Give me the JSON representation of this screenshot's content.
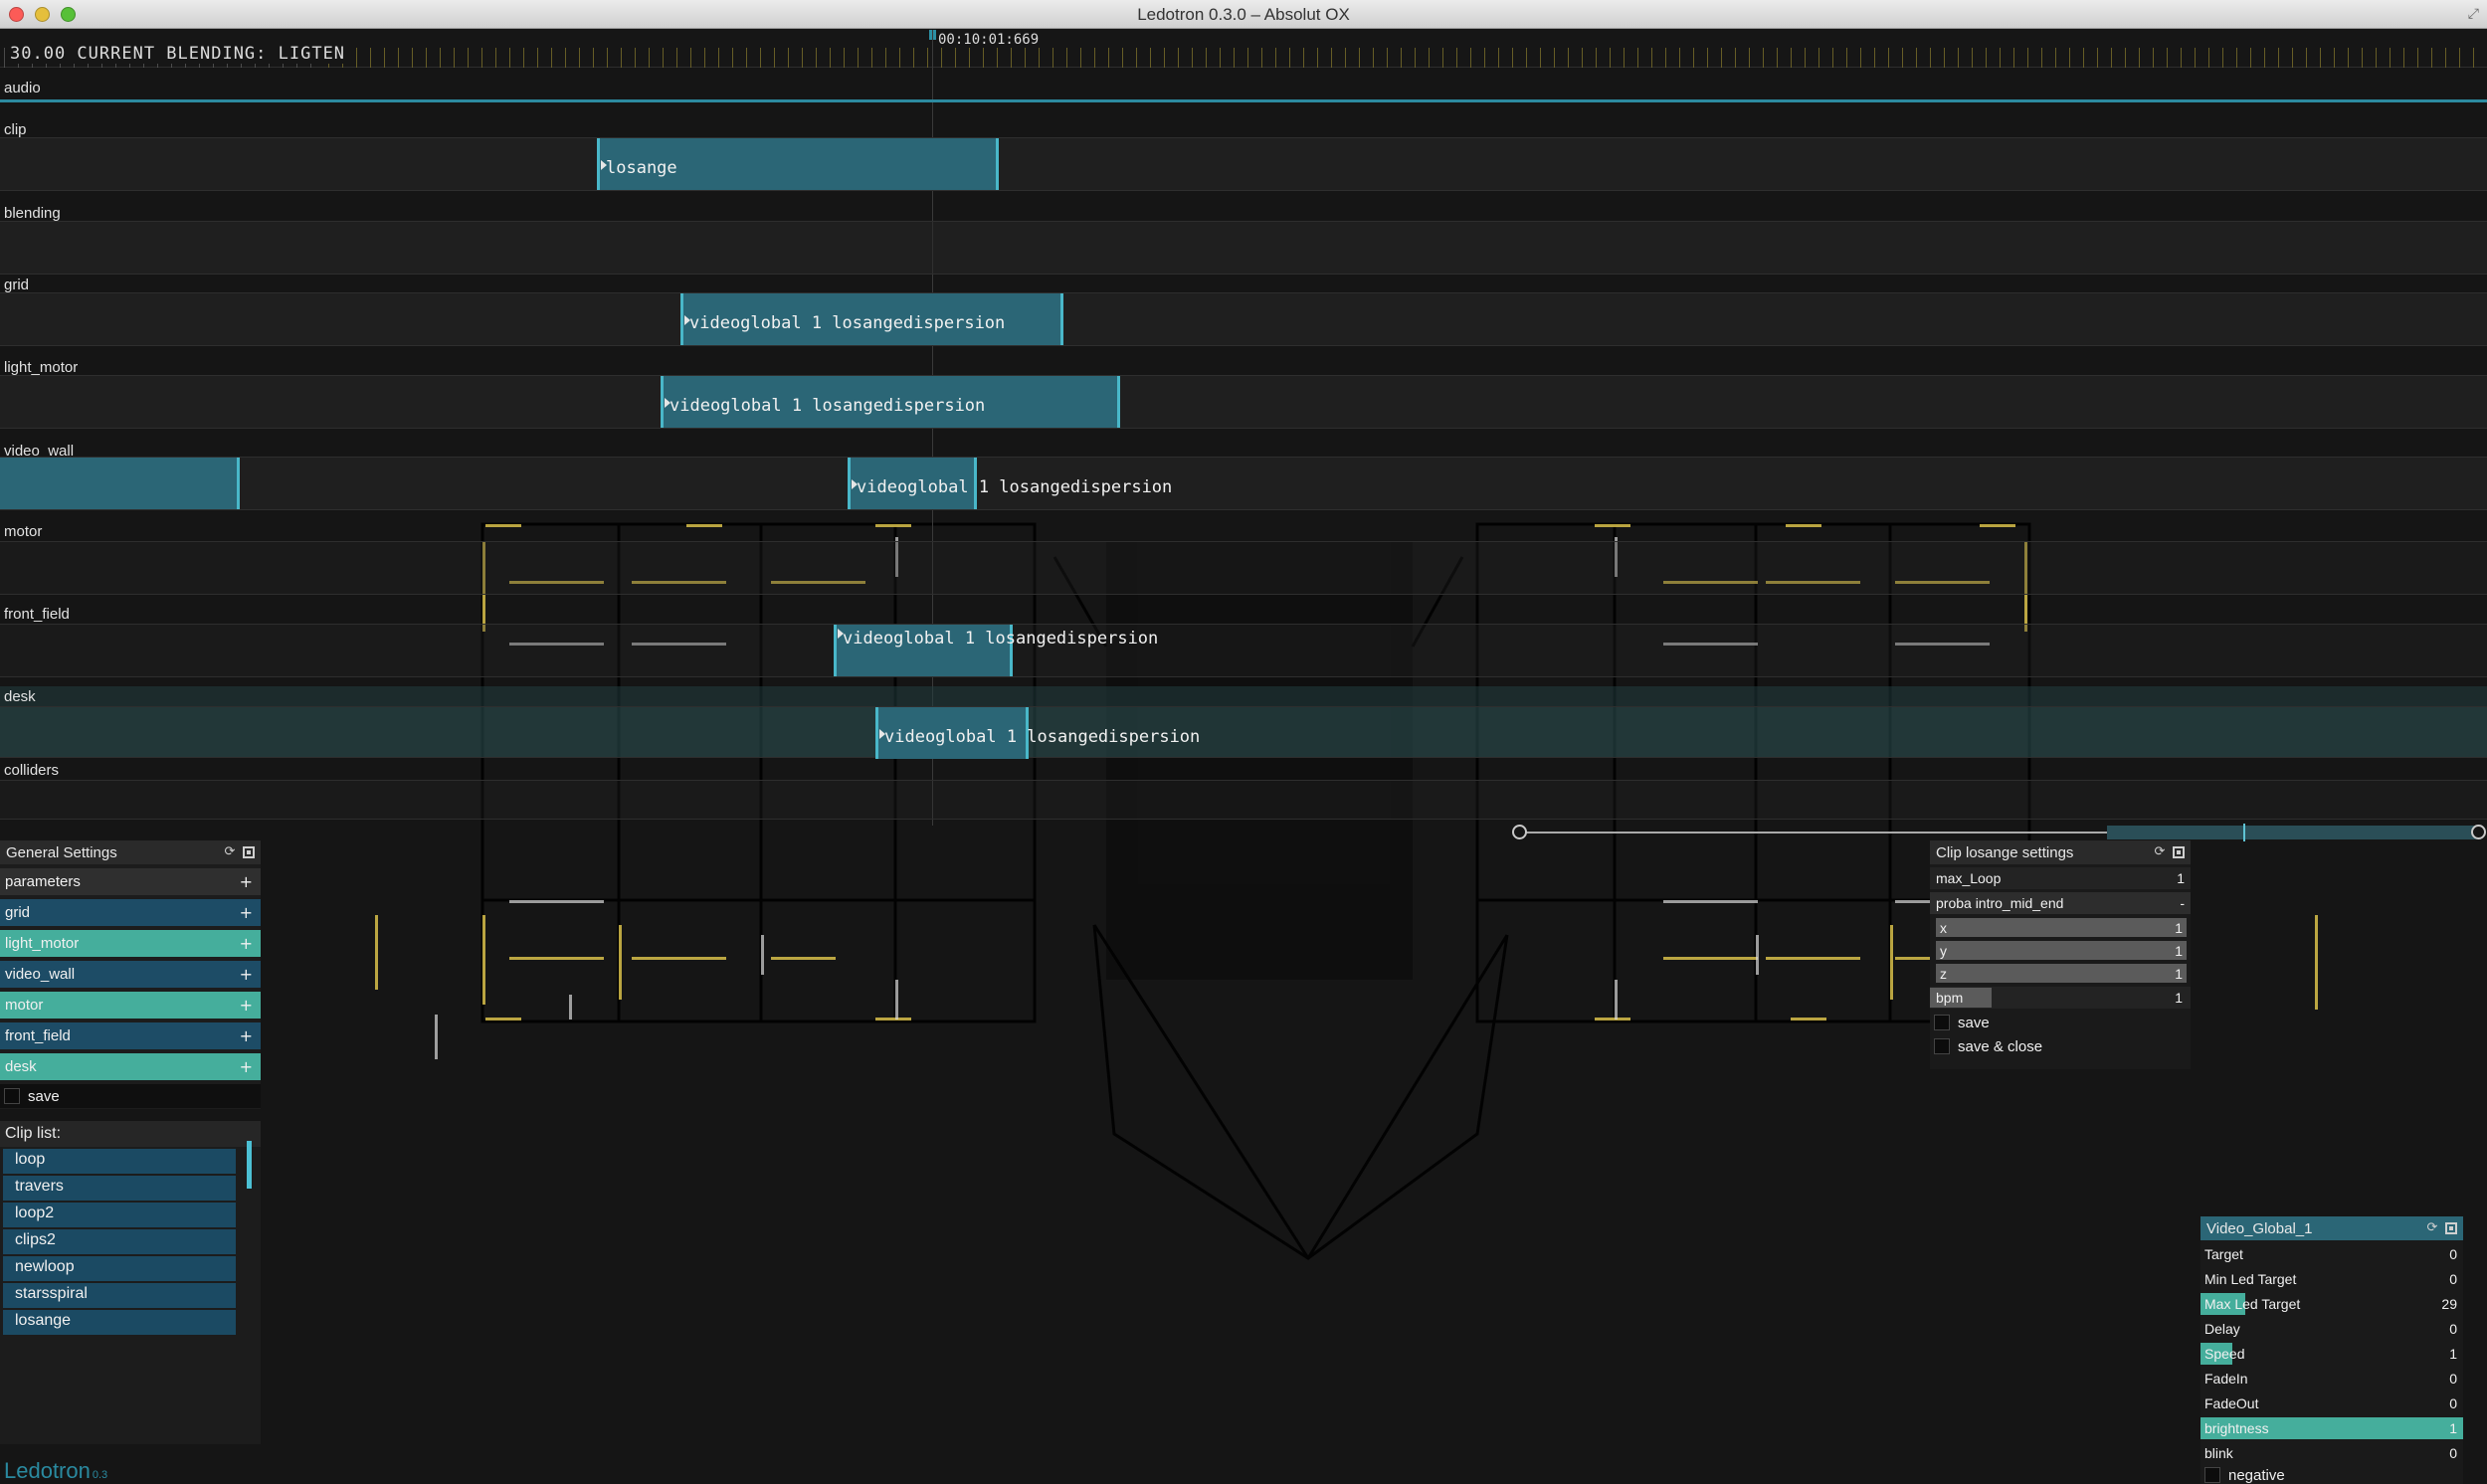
{
  "window": {
    "title": "Ledotron 0.3.0 – Absolut OX"
  },
  "ruler": {
    "status": "30.00 CURRENT BLENDING: LIGTEN",
    "time": "00:10:01:669"
  },
  "tracks": [
    {
      "label": "audio"
    },
    {
      "label": "clip",
      "clips": [
        {
          "label": "losange"
        }
      ]
    },
    {
      "label": "blending"
    },
    {
      "label": "grid",
      "clips": [
        {
          "label": "videoglobal 1 losangedispersion"
        }
      ]
    },
    {
      "label": "light_motor",
      "clips": [
        {
          "label": "videoglobal 1 losangedispersion"
        }
      ]
    },
    {
      "label": "video_wall",
      "clips": [
        {
          "label": ""
        },
        {
          "label": "videoglobal 1 losangedispersion"
        }
      ]
    },
    {
      "label": "motor"
    },
    {
      "label": "front_field",
      "clips": [
        {
          "label": "videoglobal 1 losangedispersion"
        }
      ]
    },
    {
      "label": "desk",
      "clips": [
        {
          "label": "videoglobal 1 losangedispersion"
        }
      ]
    },
    {
      "label": "colliders"
    }
  ],
  "general_settings": {
    "title": "General Settings",
    "rows": [
      {
        "label": "parameters",
        "style": "grey"
      },
      {
        "label": "grid",
        "style": "dark"
      },
      {
        "label": "light_motor",
        "style": "teal"
      },
      {
        "label": "video_wall",
        "style": "dark"
      },
      {
        "label": "motor",
        "style": "teal"
      },
      {
        "label": "front_field",
        "style": "dark"
      },
      {
        "label": "desk",
        "style": "teal"
      }
    ],
    "save_label": "save"
  },
  "clip_list": {
    "title": "Clip list:",
    "items": [
      "loop",
      "travers",
      "loop2",
      "clips2",
      "newloop",
      "starsspiral",
      "losange"
    ]
  },
  "clip_settings": {
    "title": "Clip losange settings",
    "max_loop": {
      "label": "max_Loop",
      "value": "1"
    },
    "proba": {
      "label": "proba intro_mid_end",
      "value": "-"
    },
    "x": {
      "label": "x",
      "value": "1"
    },
    "y": {
      "label": "y",
      "value": "1"
    },
    "z": {
      "label": "z",
      "value": "1"
    },
    "bpm": {
      "label": "bpm",
      "value": "1"
    },
    "save_label": "save",
    "save_close_label": "save & close"
  },
  "video_global": {
    "title": "Video_Global_1",
    "rows": [
      {
        "label": "Target",
        "value": "0",
        "fill": 0
      },
      {
        "label": "Min Led Target",
        "value": "0",
        "fill": 0
      },
      {
        "label": "Max Led Target",
        "value": "29",
        "fill": 0.17
      },
      {
        "label": "Delay",
        "value": "0",
        "fill": 0
      },
      {
        "label": "Speed",
        "value": "1",
        "fill": 0.12
      },
      {
        "label": "FadeIn",
        "value": "0",
        "fill": 0
      },
      {
        "label": "FadeOut",
        "value": "0",
        "fill": 0
      },
      {
        "label": "brightness",
        "value": "1",
        "fill": 1
      },
      {
        "label": "blink",
        "value": "0",
        "fill": 0
      }
    ],
    "negative_label": "negative"
  },
  "brand": {
    "name": "Ledotron",
    "version": "0.3"
  },
  "colors": {
    "accent": "#2b6676",
    "clip_border": "#49b7c9",
    "teal": "#45ae9c",
    "dark_blue": "#1d4c66"
  }
}
